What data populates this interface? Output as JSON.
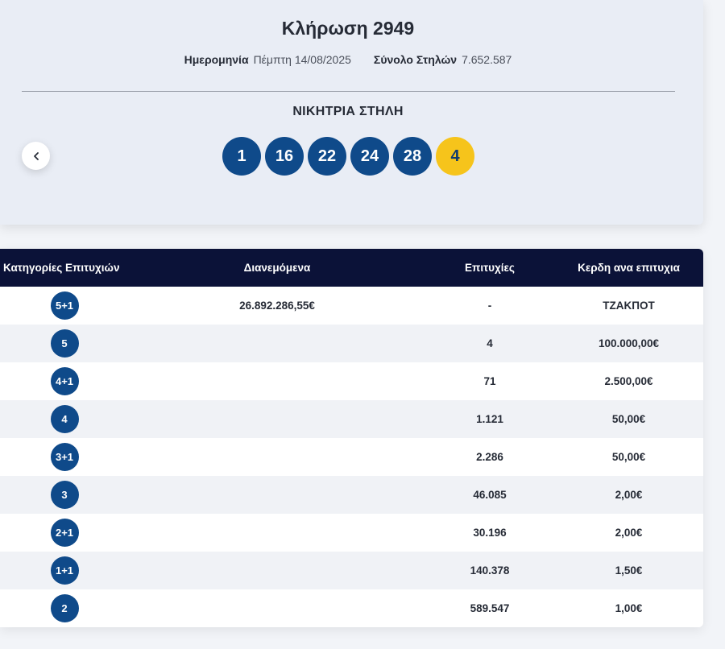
{
  "draw": {
    "title": "Κλήρωση 2949",
    "date_label": "Ημερομηνία",
    "date_value": "Πέμπτη 14/08/2025",
    "columns_label": "Σύνολο Στηλών",
    "columns_value": "7.652.587",
    "winning_title": "ΝΙΚΗΤΡΙΑ ΣΤΗΛΗ",
    "numbers": [
      "1",
      "16",
      "22",
      "24",
      "28"
    ],
    "joker": "4",
    "colors": {
      "ball": "#0f4a8a",
      "joker": "#f6c41b",
      "header": "#0b1238"
    }
  },
  "nav": {
    "prev_icon": "chevron-left-icon"
  },
  "table": {
    "headers": {
      "category": "Κατηγορίες Επιτυχιών",
      "distributed": "Διανεμόμενα",
      "winners": "Επιτυχίες",
      "prize": "Κερδη ανα επιτυχια"
    },
    "rows": [
      {
        "category": "5+1",
        "distributed": "26.892.286,55€",
        "winners": "-",
        "prize": "ΤΖΑΚΠΟΤ"
      },
      {
        "category": "5",
        "distributed": "",
        "winners": "4",
        "prize": "100.000,00€"
      },
      {
        "category": "4+1",
        "distributed": "",
        "winners": "71",
        "prize": "2.500,00€"
      },
      {
        "category": "4",
        "distributed": "",
        "winners": "1.121",
        "prize": "50,00€"
      },
      {
        "category": "3+1",
        "distributed": "",
        "winners": "2.286",
        "prize": "50,00€"
      },
      {
        "category": "3",
        "distributed": "",
        "winners": "46.085",
        "prize": "2,00€"
      },
      {
        "category": "2+1",
        "distributed": "",
        "winners": "30.196",
        "prize": "2,00€"
      },
      {
        "category": "1+1",
        "distributed": "",
        "winners": "140.378",
        "prize": "1,50€"
      },
      {
        "category": "2",
        "distributed": "",
        "winners": "589.547",
        "prize": "1,00€"
      }
    ]
  }
}
